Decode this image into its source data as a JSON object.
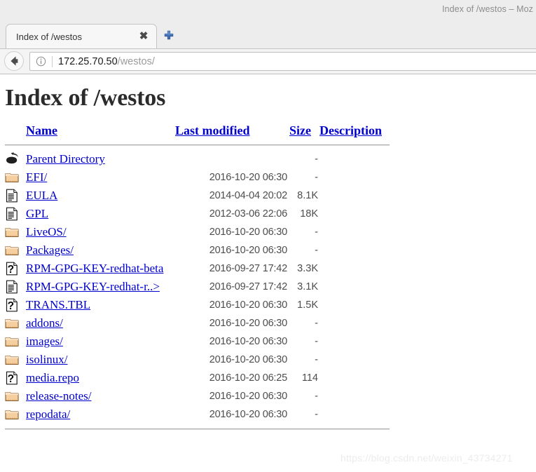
{
  "window": {
    "title": "Index of /westos – Moz"
  },
  "tabs": {
    "active_label": "Index of /westos",
    "close_glyph": "✖",
    "new_tab_title": "New Tab"
  },
  "navbar": {
    "back_title": "Back",
    "identity_title": "Site information",
    "url_host": "172.25.70.50",
    "url_path": "/westos/",
    "url_full": "172.25.70.50/westos/"
  },
  "page": {
    "heading": "Index of /westos",
    "columns": {
      "name": "Name",
      "last_modified": "Last modified",
      "size": "Size",
      "description": "Description"
    },
    "rows": [
      {
        "icon": "parent-directory-icon",
        "name": "Parent Directory",
        "date": "",
        "size": "-",
        "description": ""
      },
      {
        "icon": "folder-icon",
        "name": "EFI/",
        "date": "2016-10-20 06:30",
        "size": "-",
        "description": ""
      },
      {
        "icon": "text-file-icon",
        "name": "EULA",
        "date": "2014-04-04 20:02",
        "size": "8.1K",
        "description": ""
      },
      {
        "icon": "text-file-icon",
        "name": "GPL",
        "date": "2012-03-06 22:06",
        "size": "18K",
        "description": ""
      },
      {
        "icon": "folder-icon",
        "name": "LiveOS/",
        "date": "2016-10-20 06:30",
        "size": "-",
        "description": ""
      },
      {
        "icon": "folder-icon",
        "name": "Packages/",
        "date": "2016-10-20 06:30",
        "size": "-",
        "description": ""
      },
      {
        "icon": "unknown-file-icon",
        "name": "RPM-GPG-KEY-redhat-beta",
        "date": "2016-09-27 17:42",
        "size": "3.3K",
        "description": ""
      },
      {
        "icon": "text-file-icon",
        "name": "RPM-GPG-KEY-redhat-r..>",
        "date": "2016-09-27 17:42",
        "size": "3.1K",
        "description": ""
      },
      {
        "icon": "unknown-file-icon",
        "name": "TRANS.TBL",
        "date": "2016-10-20 06:30",
        "size": "1.5K",
        "description": ""
      },
      {
        "icon": "folder-icon",
        "name": "addons/",
        "date": "2016-10-20 06:30",
        "size": "-",
        "description": ""
      },
      {
        "icon": "folder-icon",
        "name": "images/",
        "date": "2016-10-20 06:30",
        "size": "-",
        "description": ""
      },
      {
        "icon": "folder-icon",
        "name": "isolinux/",
        "date": "2016-10-20 06:30",
        "size": "-",
        "description": ""
      },
      {
        "icon": "unknown-file-icon",
        "name": "media.repo",
        "date": "2016-10-20 06:25",
        "size": "114",
        "description": ""
      },
      {
        "icon": "folder-icon",
        "name": "release-notes/",
        "date": "2016-10-20 06:30",
        "size": "-",
        "description": ""
      },
      {
        "icon": "folder-icon",
        "name": "repodata/",
        "date": "2016-10-20 06:30",
        "size": "-",
        "description": ""
      }
    ]
  },
  "watermark": {
    "text": "https://blog.csdn.net/weixin_43734271"
  },
  "colors": {
    "link": "#0000cc",
    "chrome_bg": "#ededed",
    "folder_fill": "#f5cfa0",
    "text_gray": "#4d4d4d"
  }
}
